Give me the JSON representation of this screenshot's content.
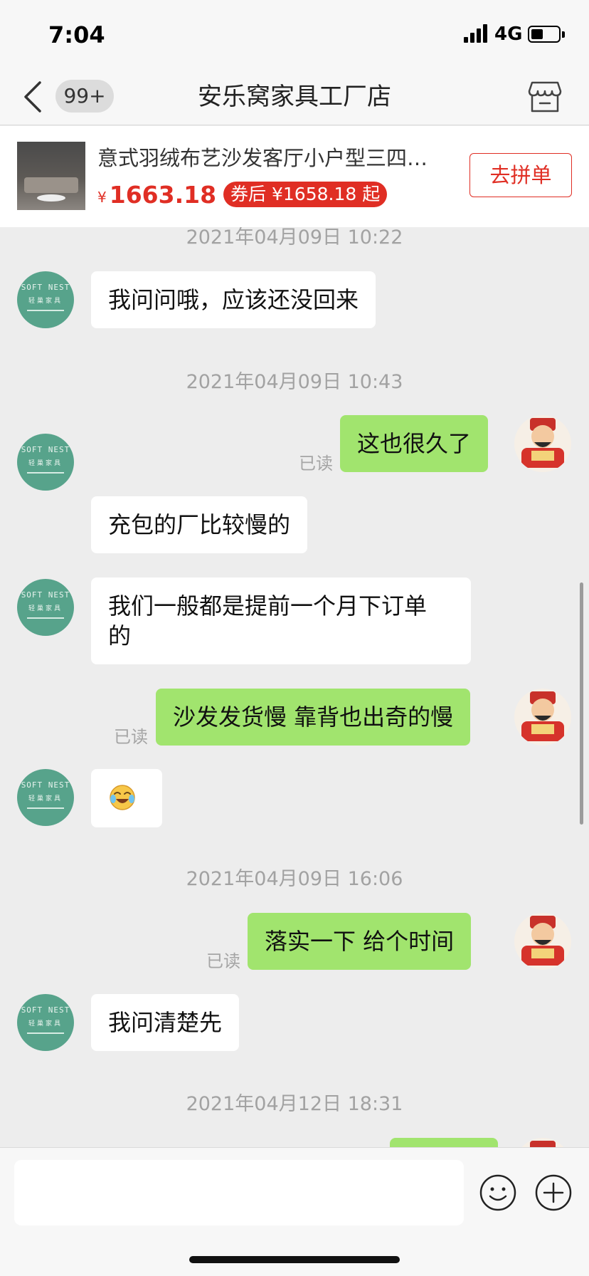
{
  "status_bar": {
    "time": "7:04",
    "network": "4G"
  },
  "nav": {
    "unread_count": "99+",
    "title": "安乐窝家具工厂店"
  },
  "product": {
    "name": "意式羽绒布艺沙发客厅小户型三四人位组合",
    "currency": "¥",
    "price": "1663.18",
    "coupon_text": "券后 ¥1658.18 起",
    "action_label": "去拼单"
  },
  "shop_avatar": {
    "line1": "SOFT NEST",
    "line2": "轻巢家具"
  },
  "chat": {
    "ts1": "2021年04月09日 10:22",
    "m1": "我问问哦，应该还没回来",
    "ts2": "2021年04月09日 10:43",
    "m2": "这也很久了",
    "read1": "已读",
    "m3": "充包的厂比较慢的",
    "m4_line1": "我们一般都是提前一个月下订单",
    "m4_line2": "的",
    "m5": "沙发发货慢  靠背也出奇的慢",
    "read2": "已读",
    "m6_icon": "crying-laughing-emoji",
    "ts3": "2021年04月09日 16:06",
    "m7": "落实一下   给个时间",
    "read3": "已读",
    "m8": "我问清楚先",
    "ts4": "2021年04月12日 18:31"
  },
  "input": {
    "placeholder": ""
  },
  "colors": {
    "accent_red": "#e02e24",
    "bubble_out": "#a1e46e",
    "bubble_in": "#ffffff",
    "shop_avatar": "#57a38b",
    "chat_bg": "#ededed"
  }
}
